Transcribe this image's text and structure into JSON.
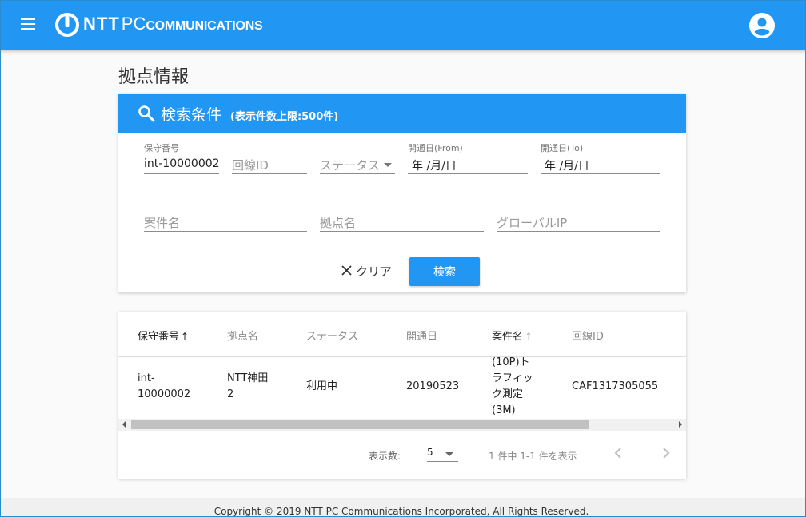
{
  "header": {
    "brand": "NTT",
    "brand_pc": "PC",
    "brand_comm": "COMMUNICATIONS",
    "colors": {
      "primary": "#2196f3"
    }
  },
  "page_title": "拠点情報",
  "search": {
    "title": "検索条件",
    "limit": "(表示件数上限:500件)",
    "fields": {
      "maintenance_no": {
        "label": "保守番号",
        "value": "int-10000002"
      },
      "line_id": {
        "placeholder": "回線ID"
      },
      "status": {
        "placeholder": "ステータス"
      },
      "open_from": {
        "label": "開通日(From)",
        "value": "年 /月/日"
      },
      "open_to": {
        "label": "開通日(To)",
        "value": "年 /月/日"
      },
      "case_name": {
        "placeholder": "案件名"
      },
      "site_name": {
        "placeholder": "拠点名"
      },
      "global_ip": {
        "placeholder": "グローバルIP"
      }
    },
    "clear_label": "クリア",
    "search_label": "検索"
  },
  "table": {
    "columns": [
      "保守番号",
      "拠点名",
      "ステータス",
      "開通日",
      "案件名",
      "回線ID"
    ],
    "sort_arrow_up": "↑",
    "rows": [
      {
        "maintenance_no": [
          "int-",
          "10000002"
        ],
        "site_name": [
          "NTT神田",
          "2"
        ],
        "status": "利用中",
        "open_date": "20190523",
        "case_name": [
          "(10P)ト",
          "ラフィッ",
          "ク測定",
          "(3M)"
        ],
        "line_id": "CAF1317305055"
      }
    ],
    "rows_per_page_label": "表示数:",
    "rows_per_page": "5",
    "range_text": "1 件中 1-1 件を表示"
  },
  "footer": {
    "copyright": "Copyright © 2019 NTT PC Communications Incorporated, All Rights Reserved."
  }
}
